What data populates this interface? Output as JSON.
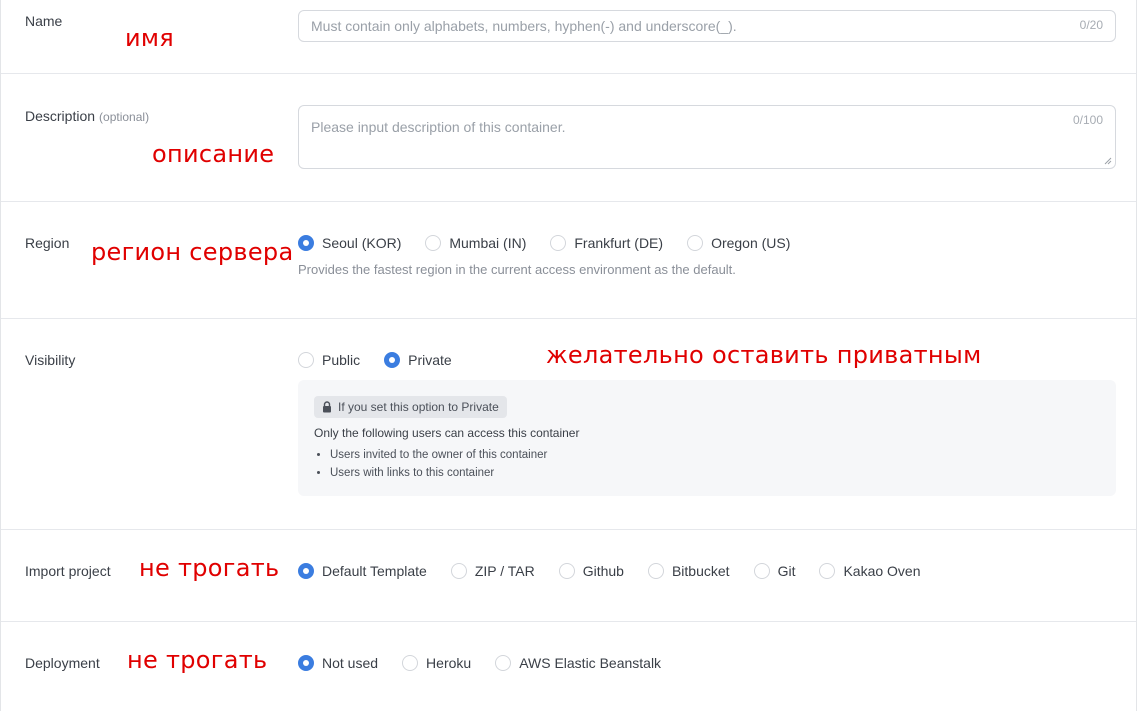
{
  "name": {
    "label": "Name",
    "placeholder": "Must contain only alphabets, numbers, hyphen(-) and underscore(_).",
    "counter": "0/20",
    "note": "имя"
  },
  "description": {
    "label": "Description",
    "optional": "(optional)",
    "placeholder": "Please input description of this container.",
    "counter": "0/100",
    "note": "описание"
  },
  "region": {
    "label": "Region",
    "note": "регион сервера",
    "options": [
      "Seoul (KOR)",
      "Mumbai (IN)",
      "Frankfurt (DE)",
      "Oregon (US)"
    ],
    "selected": "Seoul (KOR)",
    "helper": "Provides the fastest region in the current access environment as the default."
  },
  "visibility": {
    "label": "Visibility",
    "note": "желательно оставить приватным",
    "options": [
      "Public",
      "Private"
    ],
    "selected": "Private",
    "info": {
      "badge": "If you set this option to Private",
      "text": "Only the following users can access this container",
      "items": [
        "Users invited to the owner of this container",
        "Users with links to this container"
      ]
    }
  },
  "import": {
    "label": "Import project",
    "note": "не трогать",
    "options": [
      "Default Template",
      "ZIP / TAR",
      "Github",
      "Bitbucket",
      "Git",
      "Kakao Oven"
    ],
    "selected": "Default Template"
  },
  "deployment": {
    "label": "Deployment",
    "note": "не трогать",
    "options": [
      "Not used",
      "Heroku",
      "AWS Elastic Beanstalk"
    ],
    "selected": "Not used"
  },
  "colors": {
    "accent": "#3b7de0",
    "note": "#e00000",
    "border": "#d6d9de"
  },
  "icons": [
    "lock-icon",
    "resize-grip-icon"
  ]
}
